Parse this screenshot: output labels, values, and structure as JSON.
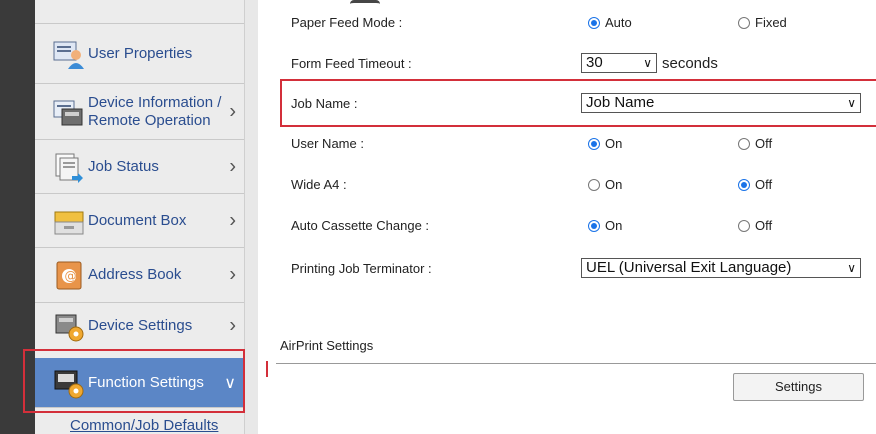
{
  "sidebar": {
    "items": [
      {
        "label": "User Properties",
        "icon": "user-properties-icon"
      },
      {
        "label_1": "Device Information /",
        "label_2": "Remote Operation",
        "icon": "device-information-icon"
      },
      {
        "label": "Job Status",
        "icon": "job-status-icon"
      },
      {
        "label": "Document Box",
        "icon": "document-box-icon"
      },
      {
        "label": "Address Book",
        "icon": "address-book-icon"
      },
      {
        "label": "Device Settings",
        "icon": "device-settings-icon"
      },
      {
        "label": "Function Settings",
        "icon": "function-settings-icon"
      }
    ],
    "sub_link": "Common/Job Defaults"
  },
  "settings": {
    "paper_feed_mode": {
      "label": "Paper Feed Mode :",
      "opt1": "Auto",
      "opt2": "Fixed",
      "selected": "Auto"
    },
    "form_feed_timeout": {
      "label": "Form Feed Timeout :",
      "value": "30",
      "unit": "seconds"
    },
    "job_name": {
      "label": "Job Name :",
      "value": "Job Name"
    },
    "user_name": {
      "label": "User Name :",
      "opt1": "On",
      "opt2": "Off",
      "selected": "On"
    },
    "wide_a4": {
      "label": "Wide A4 :",
      "opt1": "On",
      "opt2": "Off",
      "selected": "Off"
    },
    "auto_cassette_change": {
      "label": "Auto Cassette Change :",
      "opt1": "On",
      "opt2": "Off",
      "selected": "On"
    },
    "printing_job_terminator": {
      "label": "Printing Job Terminator :",
      "value": "UEL (Universal Exit Language)"
    }
  },
  "airprint": {
    "heading": "AirPrint Settings",
    "button": "Settings"
  },
  "colors": {
    "accent": "#1a73e8",
    "active_item": "#5b86c6",
    "highlight": "#d32f3a",
    "link": "#2a4d8f"
  }
}
